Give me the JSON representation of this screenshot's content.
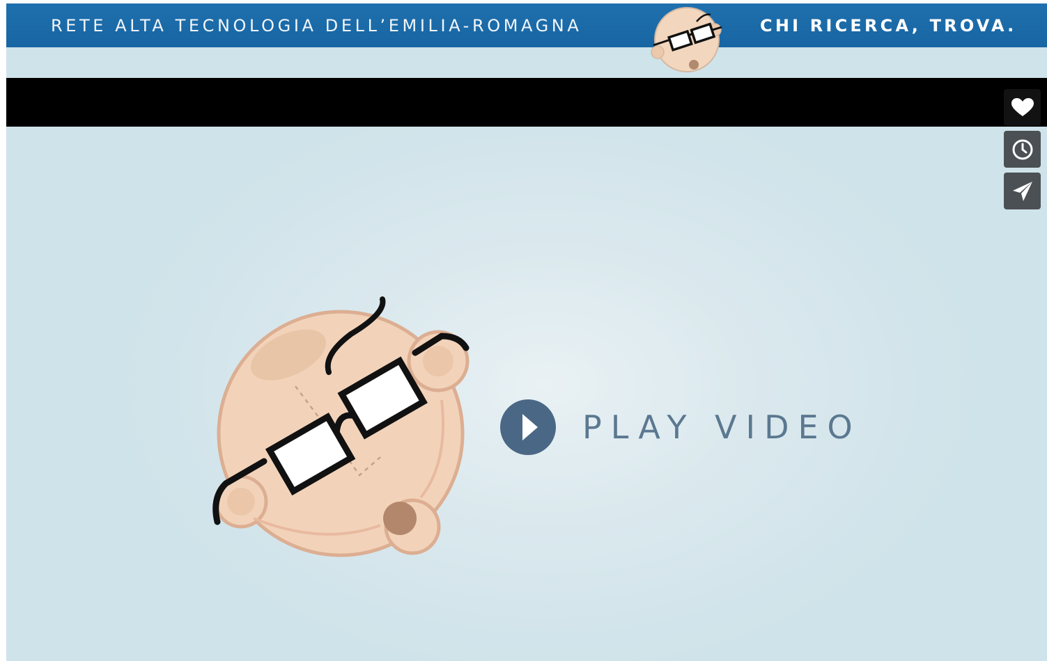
{
  "banner": {
    "left_text": "RETE ALTA TECNOLOGIA DELL’EMILIA-ROMAGNA",
    "right_text": "CHI RICERCA, TROVA.",
    "logo_icon": "researcher-face-logo",
    "color": "#1a69a8"
  },
  "video": {
    "play_label": "PLAY VIDEO",
    "play_icon": "play-icon",
    "play_color": "#4a6885",
    "mascot_icon": "researcher-face-illustration"
  },
  "side_actions": [
    {
      "name": "like-button",
      "icon": "heart-icon"
    },
    {
      "name": "watch-later-button",
      "icon": "clock-icon"
    },
    {
      "name": "share-button",
      "icon": "paper-plane-icon"
    }
  ]
}
